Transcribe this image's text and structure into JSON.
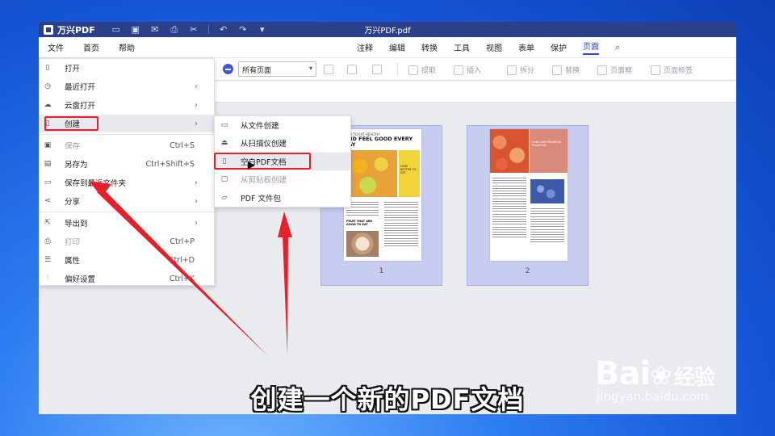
{
  "titlebar": {
    "app_name": "万兴PDF",
    "doc_title": "万兴PDF.pdf",
    "quick_actions": [
      "folder-icon",
      "save-icon",
      "mail-icon",
      "print-icon",
      "scissors-icon",
      "undo-icon",
      "redo-icon",
      "dropdown-icon"
    ]
  },
  "menubar": {
    "left": [
      "文件",
      "首页",
      "帮助"
    ],
    "right": [
      "注释",
      "编辑",
      "转换",
      "工具",
      "视图",
      "表单",
      "保护",
      "页面"
    ],
    "active": "页面"
  },
  "toolbar": {
    "page_select": "所有页面",
    "items": [
      "提取",
      "插入",
      "拆分",
      "替换",
      "页面框",
      "页面标签"
    ]
  },
  "file_menu": {
    "items": [
      {
        "label": "打开",
        "icon": "file-icon",
        "shortcut": "",
        "arrow": false,
        "disabled": false
      },
      {
        "label": "最近打开",
        "icon": "clock-icon",
        "shortcut": "",
        "arrow": true,
        "disabled": false
      },
      {
        "label": "云盘打开",
        "icon": "cloud-icon",
        "shortcut": "",
        "arrow": true,
        "disabled": false
      },
      {
        "label": "创建",
        "icon": "new-file-icon",
        "shortcut": "",
        "arrow": true,
        "disabled": false
      },
      {
        "label": "保存",
        "icon": "save-icon",
        "shortcut": "Ctrl+S",
        "arrow": false,
        "disabled": true
      },
      {
        "label": "另存为",
        "icon": "save-as-icon",
        "shortcut": "Ctrl+Shift+S",
        "arrow": false,
        "disabled": false
      },
      {
        "label": "保存到最近文件夹",
        "icon": "folder-clock-icon",
        "shortcut": "",
        "arrow": true,
        "disabled": false
      },
      {
        "label": "分享",
        "icon": "share-icon",
        "shortcut": "",
        "arrow": true,
        "disabled": false
      },
      {
        "label": "导出到",
        "icon": "export-icon",
        "shortcut": "",
        "arrow": true,
        "disabled": false
      },
      {
        "label": "打印",
        "icon": "print-icon",
        "shortcut": "Ctrl+P",
        "arrow": false,
        "disabled": true
      },
      {
        "label": "属性",
        "icon": "properties-icon",
        "shortcut": "Ctrl+D",
        "arrow": false,
        "disabled": false
      },
      {
        "label": "偏好设置",
        "icon": "sliders-icon",
        "shortcut": "Ctrl+K",
        "arrow": false,
        "disabled": false
      }
    ]
  },
  "create_submenu": {
    "items": [
      {
        "label": "从文件创建",
        "icon": "folder-icon",
        "disabled": false
      },
      {
        "label": "从扫描仪创建",
        "icon": "scanner-icon",
        "disabled": false
      },
      {
        "label": "空白PDF文档",
        "icon": "blank-page-icon",
        "disabled": false
      },
      {
        "label": "从剪贴板创建",
        "icon": "clipboard-icon",
        "disabled": true
      },
      {
        "label": "PDF 文件包",
        "icon": "open-folder-icon",
        "disabled": false
      }
    ]
  },
  "pages": [
    {
      "number": "1",
      "headline_small": "HOW TO EAT HEALTHY",
      "headline": "AND FEEL GOOD EVERY DAY",
      "side_text": "HOW BETTER TO EAT",
      "box_title": "FRUIT THAT ARE GOOD TO EAT",
      "accent": "#f2d33a"
    },
    {
      "number": "2",
      "side_text": "Fruits with Beneficial Properties",
      "accent": "#d98a7c"
    }
  ],
  "caption": "创建一个新的PDF文档",
  "watermark": {
    "brand": "Bai",
    "brand_suffix": "经验",
    "url": "jingyan.baidu.com"
  }
}
